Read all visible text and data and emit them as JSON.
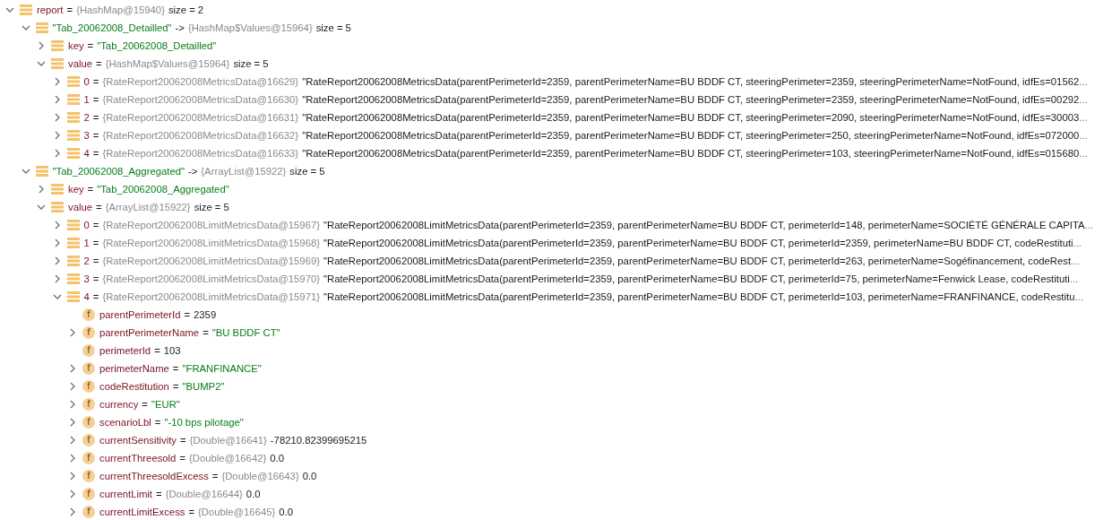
{
  "variables": [
    {
      "kind": "list",
      "expanded": true,
      "parts": [
        {
          "kind": "name",
          "text": "report"
        },
        {
          "kind": "plain",
          "text": "="
        },
        {
          "kind": "ref",
          "text": "{HashMap@15940}"
        },
        {
          "kind": "plain",
          "text": "size = 2"
        }
      ],
      "children": [
        {
          "kind": "list",
          "expanded": true,
          "parts": [
            {
              "kind": "string",
              "text": "\"Tab_20062008_Detailled\""
            },
            {
              "kind": "plain",
              "text": "->"
            },
            {
              "kind": "ref",
              "text": "{HashMap$Values@15964}"
            },
            {
              "kind": "plain",
              "text": "size = 5"
            }
          ],
          "children": [
            {
              "kind": "list",
              "expanded": false,
              "parts": [
                {
                  "kind": "name",
                  "text": "key"
                },
                {
                  "kind": "plain",
                  "text": "="
                },
                {
                  "kind": "string",
                  "text": "\"Tab_20062008_Detailled\""
                }
              ]
            },
            {
              "kind": "list",
              "expanded": true,
              "parts": [
                {
                  "kind": "name",
                  "text": "value"
                },
                {
                  "kind": "plain",
                  "text": "="
                },
                {
                  "kind": "ref",
                  "text": "{HashMap$Values@15964}"
                },
                {
                  "kind": "plain",
                  "text": "size = 5"
                }
              ],
              "children": [
                {
                  "kind": "list",
                  "expanded": false,
                  "parts": [
                    {
                      "kind": "name",
                      "text": "0"
                    },
                    {
                      "kind": "plain",
                      "text": "="
                    },
                    {
                      "kind": "ref",
                      "text": "{RateReport20062008MetricsData@16629}"
                    },
                    {
                      "kind": "plain",
                      "text": "\"RateReport20062008MetricsData(parentPerimeterId=2359, parentPerimeterName=BU BDDF CT, steeringPerimeter=2359, steeringPerimeterName=NotFound, idfEs=01562"
                    },
                    {
                      "kind": "more",
                      "text": "..."
                    }
                  ]
                },
                {
                  "kind": "list",
                  "expanded": false,
                  "parts": [
                    {
                      "kind": "name",
                      "text": "1"
                    },
                    {
                      "kind": "plain",
                      "text": "="
                    },
                    {
                      "kind": "ref",
                      "text": "{RateReport20062008MetricsData@16630}"
                    },
                    {
                      "kind": "plain",
                      "text": "\"RateReport20062008MetricsData(parentPerimeterId=2359, parentPerimeterName=BU BDDF CT, steeringPerimeter=2359, steeringPerimeterName=NotFound, idfEs=00292"
                    },
                    {
                      "kind": "more",
                      "text": "..."
                    }
                  ]
                },
                {
                  "kind": "list",
                  "expanded": false,
                  "parts": [
                    {
                      "kind": "name",
                      "text": "2"
                    },
                    {
                      "kind": "plain",
                      "text": "="
                    },
                    {
                      "kind": "ref",
                      "text": "{RateReport20062008MetricsData@16631}"
                    },
                    {
                      "kind": "plain",
                      "text": "\"RateReport20062008MetricsData(parentPerimeterId=2359, parentPerimeterName=BU BDDF CT, steeringPerimeter=2090, steeringPerimeterName=NotFound, idfEs=30003"
                    },
                    {
                      "kind": "more",
                      "text": "..."
                    }
                  ]
                },
                {
                  "kind": "list",
                  "expanded": false,
                  "parts": [
                    {
                      "kind": "name",
                      "text": "3"
                    },
                    {
                      "kind": "plain",
                      "text": "="
                    },
                    {
                      "kind": "ref",
                      "text": "{RateReport20062008MetricsData@16632}"
                    },
                    {
                      "kind": "plain",
                      "text": "\"RateReport20062008MetricsData(parentPerimeterId=2359, parentPerimeterName=BU BDDF CT, steeringPerimeter=250, steeringPerimeterName=NotFound, idfEs=072000"
                    },
                    {
                      "kind": "more",
                      "text": "..."
                    }
                  ]
                },
                {
                  "kind": "list",
                  "expanded": false,
                  "parts": [
                    {
                      "kind": "name",
                      "text": "4"
                    },
                    {
                      "kind": "plain",
                      "text": "="
                    },
                    {
                      "kind": "ref",
                      "text": "{RateReport20062008MetricsData@16633}"
                    },
                    {
                      "kind": "plain",
                      "text": "\"RateReport20062008MetricsData(parentPerimeterId=2359, parentPerimeterName=BU BDDF CT, steeringPerimeter=103, steeringPerimeterName=NotFound, idfEs=015680"
                    },
                    {
                      "kind": "more",
                      "text": "..."
                    }
                  ]
                }
              ]
            }
          ]
        },
        {
          "kind": "list",
          "expanded": true,
          "parts": [
            {
              "kind": "string",
              "text": "\"Tab_20062008_Aggregated\""
            },
            {
              "kind": "plain",
              "text": "->"
            },
            {
              "kind": "ref",
              "text": "{ArrayList@15922}"
            },
            {
              "kind": "plain",
              "text": "size = 5"
            }
          ],
          "children": [
            {
              "kind": "list",
              "expanded": false,
              "parts": [
                {
                  "kind": "name",
                  "text": "key"
                },
                {
                  "kind": "plain",
                  "text": "="
                },
                {
                  "kind": "string",
                  "text": "\"Tab_20062008_Aggregated\""
                }
              ]
            },
            {
              "kind": "list",
              "expanded": true,
              "parts": [
                {
                  "kind": "name",
                  "text": "value"
                },
                {
                  "kind": "plain",
                  "text": "="
                },
                {
                  "kind": "ref",
                  "text": "{ArrayList@15922}"
                },
                {
                  "kind": "plain",
                  "text": "size = 5"
                }
              ],
              "children": [
                {
                  "kind": "list",
                  "expanded": false,
                  "parts": [
                    {
                      "kind": "name",
                      "text": "0"
                    },
                    {
                      "kind": "plain",
                      "text": "="
                    },
                    {
                      "kind": "ref",
                      "text": "{RateReport20062008LimitMetricsData@15967}"
                    },
                    {
                      "kind": "plain",
                      "text": "\"RateReport20062008LimitMetricsData(parentPerimeterId=2359, parentPerimeterName=BU BDDF CT, perimeterId=148, perimeterName=SOCIÉTÉ GÉNÉRALE CAPITA"
                    },
                    {
                      "kind": "more",
                      "text": "..."
                    }
                  ]
                },
                {
                  "kind": "list",
                  "expanded": false,
                  "parts": [
                    {
                      "kind": "name",
                      "text": "1"
                    },
                    {
                      "kind": "plain",
                      "text": "="
                    },
                    {
                      "kind": "ref",
                      "text": "{RateReport20062008LimitMetricsData@15968}"
                    },
                    {
                      "kind": "plain",
                      "text": "\"RateReport20062008LimitMetricsData(parentPerimeterId=2359, parentPerimeterName=BU BDDF CT, perimeterId=2359, perimeterName=BU BDDF CT, codeRestituti"
                    },
                    {
                      "kind": "more",
                      "text": "..."
                    }
                  ]
                },
                {
                  "kind": "list",
                  "expanded": false,
                  "parts": [
                    {
                      "kind": "name",
                      "text": "2"
                    },
                    {
                      "kind": "plain",
                      "text": "="
                    },
                    {
                      "kind": "ref",
                      "text": "{RateReport20062008LimitMetricsData@15969}"
                    },
                    {
                      "kind": "plain",
                      "text": "\"RateReport20062008LimitMetricsData(parentPerimeterId=2359, parentPerimeterName=BU BDDF CT, perimeterId=263, perimeterName=Sogéfinancement, codeRest"
                    },
                    {
                      "kind": "more",
                      "text": "..."
                    }
                  ]
                },
                {
                  "kind": "list",
                  "expanded": false,
                  "parts": [
                    {
                      "kind": "name",
                      "text": "3"
                    },
                    {
                      "kind": "plain",
                      "text": "="
                    },
                    {
                      "kind": "ref",
                      "text": "{RateReport20062008LimitMetricsData@15970}"
                    },
                    {
                      "kind": "plain",
                      "text": "\"RateReport20062008LimitMetricsData(parentPerimeterId=2359, parentPerimeterName=BU BDDF CT, perimeterId=75, perimeterName=Fenwick Lease, codeRestituti"
                    },
                    {
                      "kind": "more",
                      "text": "..."
                    }
                  ]
                },
                {
                  "kind": "list",
                  "expanded": true,
                  "parts": [
                    {
                      "kind": "name",
                      "text": "4"
                    },
                    {
                      "kind": "plain",
                      "text": "="
                    },
                    {
                      "kind": "ref",
                      "text": "{RateReport20062008LimitMetricsData@15971}"
                    },
                    {
                      "kind": "plain",
                      "text": "\"RateReport20062008LimitMetricsData(parentPerimeterId=2359, parentPerimeterName=BU BDDF CT, perimeterId=103, perimeterName=FRANFINANCE, codeRestitu"
                    },
                    {
                      "kind": "more",
                      "text": "..."
                    }
                  ],
                  "children": [
                    {
                      "kind": "field",
                      "icon_text": "f",
                      "parts": [
                        {
                          "kind": "name",
                          "text": "parentPerimeterId"
                        },
                        {
                          "kind": "plain",
                          "text": "="
                        },
                        {
                          "kind": "plain",
                          "text": "2359"
                        }
                      ]
                    },
                    {
                      "kind": "field",
                      "icon_text": "f",
                      "expanded": false,
                      "parts": [
                        {
                          "kind": "name",
                          "text": "parentPerimeterName"
                        },
                        {
                          "kind": "plain",
                          "text": "="
                        },
                        {
                          "kind": "string",
                          "text": "\"BU BDDF CT\""
                        }
                      ]
                    },
                    {
                      "kind": "field",
                      "icon_text": "f",
                      "parts": [
                        {
                          "kind": "name",
                          "text": "perimeterId"
                        },
                        {
                          "kind": "plain",
                          "text": "="
                        },
                        {
                          "kind": "plain",
                          "text": "103"
                        }
                      ]
                    },
                    {
                      "kind": "field",
                      "icon_text": "f",
                      "expanded": false,
                      "parts": [
                        {
                          "kind": "name",
                          "text": "perimeterName"
                        },
                        {
                          "kind": "plain",
                          "text": "="
                        },
                        {
                          "kind": "string",
                          "text": "\"FRANFINANCE\""
                        }
                      ]
                    },
                    {
                      "kind": "field",
                      "icon_text": "f",
                      "expanded": false,
                      "parts": [
                        {
                          "kind": "name",
                          "text": "codeRestitution"
                        },
                        {
                          "kind": "plain",
                          "text": "="
                        },
                        {
                          "kind": "string",
                          "text": "\"BUMP2\""
                        }
                      ]
                    },
                    {
                      "kind": "field",
                      "icon_text": "f",
                      "expanded": false,
                      "parts": [
                        {
                          "kind": "name",
                          "text": "currency"
                        },
                        {
                          "kind": "plain",
                          "text": "="
                        },
                        {
                          "kind": "string",
                          "text": "\"EUR\""
                        }
                      ]
                    },
                    {
                      "kind": "field",
                      "icon_text": "f",
                      "expanded": false,
                      "parts": [
                        {
                          "kind": "name",
                          "text": "scenarioLbl"
                        },
                        {
                          "kind": "plain",
                          "text": "="
                        },
                        {
                          "kind": "string",
                          "text": "\"-10 bps pilotage\""
                        }
                      ]
                    },
                    {
                      "kind": "field",
                      "icon_text": "f",
                      "expanded": false,
                      "parts": [
                        {
                          "kind": "name",
                          "text": "currentSensitivity"
                        },
                        {
                          "kind": "plain",
                          "text": "="
                        },
                        {
                          "kind": "ref",
                          "text": "{Double@16641}"
                        },
                        {
                          "kind": "plain",
                          "text": "-78210.82399695215"
                        }
                      ]
                    },
                    {
                      "kind": "field",
                      "icon_text": "f",
                      "expanded": false,
                      "parts": [
                        {
                          "kind": "name",
                          "text": "currentThreesold"
                        },
                        {
                          "kind": "plain",
                          "text": "="
                        },
                        {
                          "kind": "ref",
                          "text": "{Double@16642}"
                        },
                        {
                          "kind": "plain",
                          "text": "0.0"
                        }
                      ]
                    },
                    {
                      "kind": "field",
                      "icon_text": "f",
                      "expanded": false,
                      "parts": [
                        {
                          "kind": "name",
                          "text": "currentThreesoldExcess"
                        },
                        {
                          "kind": "plain",
                          "text": "="
                        },
                        {
                          "kind": "ref",
                          "text": "{Double@16643}"
                        },
                        {
                          "kind": "plain",
                          "text": "0.0"
                        }
                      ]
                    },
                    {
                      "kind": "field",
                      "icon_text": "f",
                      "expanded": false,
                      "parts": [
                        {
                          "kind": "name",
                          "text": "currentLimit"
                        },
                        {
                          "kind": "plain",
                          "text": "="
                        },
                        {
                          "kind": "ref",
                          "text": "{Double@16644}"
                        },
                        {
                          "kind": "plain",
                          "text": "0.0"
                        }
                      ]
                    },
                    {
                      "kind": "field",
                      "icon_text": "f",
                      "expanded": false,
                      "parts": [
                        {
                          "kind": "name",
                          "text": "currentLimitExcess"
                        },
                        {
                          "kind": "plain",
                          "text": "="
                        },
                        {
                          "kind": "ref",
                          "text": "{Double@16645}"
                        },
                        {
                          "kind": "plain",
                          "text": "0.0"
                        }
                      ]
                    }
                  ]
                }
              ]
            }
          ]
        }
      ]
    }
  ]
}
